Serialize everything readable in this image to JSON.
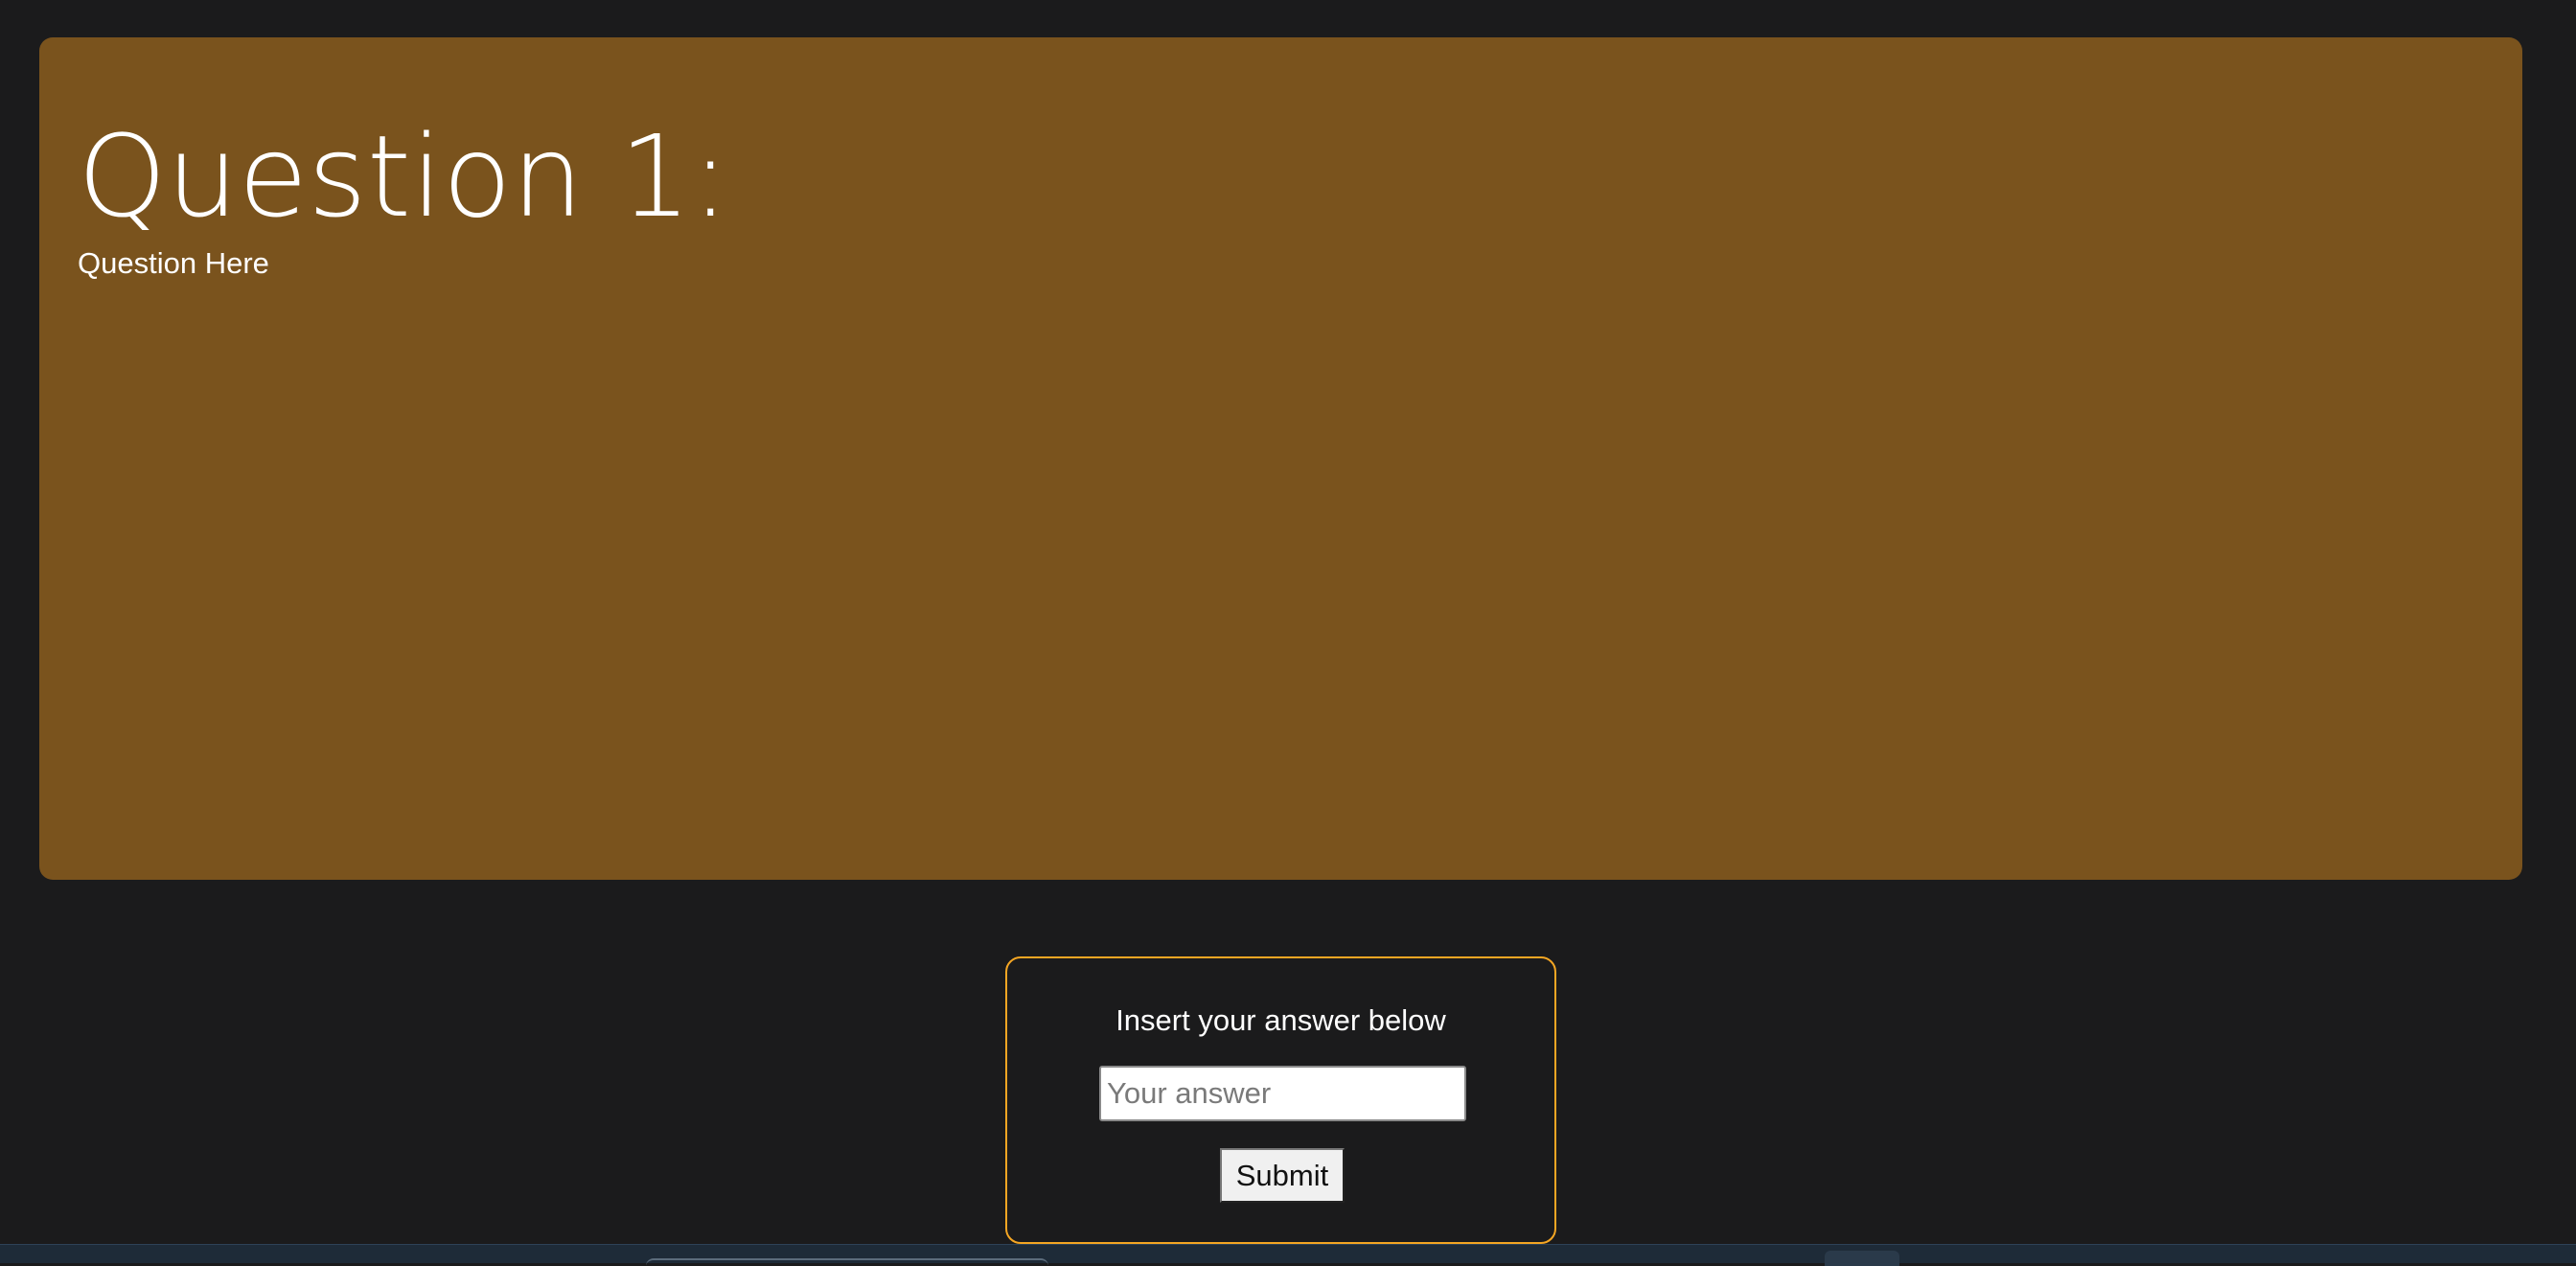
{
  "question": {
    "title": "Question 1:",
    "text": "Question Here"
  },
  "answer": {
    "prompt": "Insert your answer below",
    "input_value": "",
    "input_placeholder": "Your answer",
    "submit_label": "Submit"
  },
  "colors": {
    "page_background": "#1b1b1c",
    "question_panel": "#7a531d",
    "answer_border": "#f5a623",
    "taskbar": "#1e2b38"
  }
}
